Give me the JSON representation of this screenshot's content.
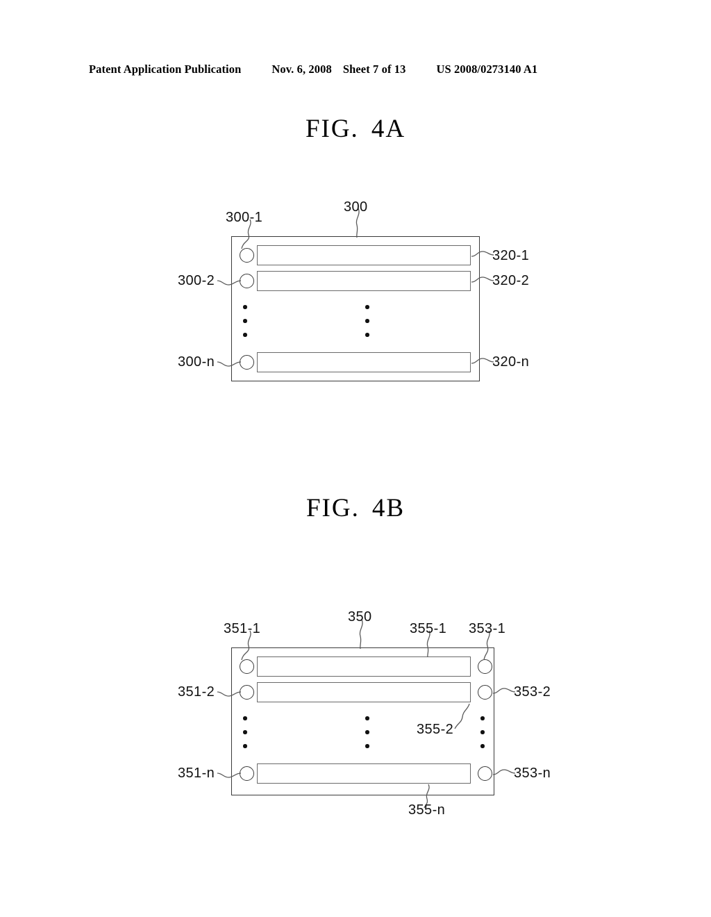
{
  "header": {
    "publication": "Patent Application Publication",
    "date": "Nov. 6, 2008",
    "sheet": "Sheet 7 of 13",
    "patent_number": "US 2008/0273140 A1"
  },
  "figures": [
    {
      "id": "fig-4a",
      "title_prefix": "FIG.",
      "title_suffix": "4A",
      "enclosure_label": "300",
      "rows": [
        {
          "left_label": "300-1",
          "bar_label": "320-1"
        },
        {
          "left_label": "300-2",
          "bar_label": "320-2"
        },
        {
          "left_label": "300-n",
          "bar_label": "320-n"
        }
      ],
      "ellipsis_dots": 3
    },
    {
      "id": "fig-4b",
      "title_prefix": "FIG.",
      "title_suffix": "4B",
      "enclosure_label": "350",
      "rows": [
        {
          "left_label": "351-1",
          "bar_label": "355-1",
          "right_label": "353-1"
        },
        {
          "left_label": "351-2",
          "bar_label": "355-2",
          "right_label": "353-2"
        },
        {
          "left_label": "351-n",
          "bar_label": "355-n",
          "right_label": "353-n"
        }
      ],
      "ellipsis_dots": 3
    }
  ],
  "colors": {
    "ink": "#000000",
    "line": "#3a3a3a",
    "line_light": "#6a6a6a",
    "paper": "#ffffff"
  }
}
